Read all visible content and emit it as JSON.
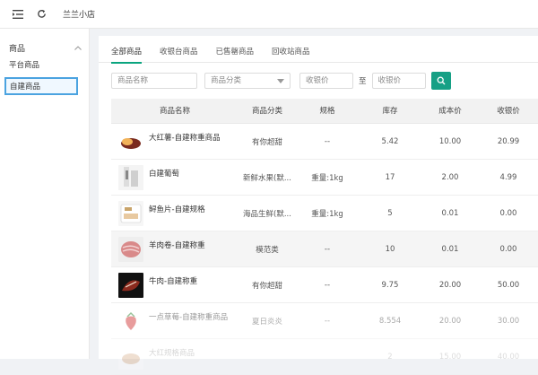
{
  "header": {
    "shop_name": "兰兰小店",
    "menu_icon": "menu-fold-icon",
    "refresh_icon": "refresh-icon"
  },
  "sidebar": {
    "group_label": "商品",
    "items": [
      {
        "label": "平台商品",
        "active": false
      },
      {
        "label": "自建商品",
        "active": true
      }
    ]
  },
  "tabs": [
    {
      "label": "全部商品",
      "active": true
    },
    {
      "label": "收银台商品",
      "active": false
    },
    {
      "label": "已售罄商品",
      "active": false
    },
    {
      "label": "回收站商品",
      "active": false
    }
  ],
  "filters": {
    "name_placeholder": "商品名称",
    "category_placeholder": "商品分类",
    "price_min_placeholder": "收银价",
    "to_label": "至",
    "price_max_placeholder": "收银价"
  },
  "accent_color": "#16a085",
  "table": {
    "columns": [
      "商品名称",
      "商品分类",
      "规格",
      "库存",
      "成本价",
      "收银价"
    ],
    "rows": [
      {
        "name": "大红薯-自建称重商品",
        "category": "有你超甜",
        "spec": "--",
        "stock": "5.42",
        "cost": "10.00",
        "price": "20.99"
      },
      {
        "name": "白建葡萄",
        "category": "新鲜水果(默...",
        "spec": "重量:1kg",
        "stock": "17",
        "cost": "2.00",
        "price": "4.99"
      },
      {
        "name": "鲟鱼片-自建规格",
        "category": "海品生鲜(默...",
        "spec": "重量:1kg",
        "stock": "5",
        "cost": "0.01",
        "price": "0.00"
      },
      {
        "name": "羊肉卷-自建称重",
        "category": "模范类",
        "spec": "--",
        "stock": "10",
        "cost": "0.01",
        "price": "0.00"
      },
      {
        "name": "牛肉-自建称重",
        "category": "有你超甜",
        "spec": "--",
        "stock": "9.75",
        "cost": "20.00",
        "price": "50.00"
      },
      {
        "name": "一点草莓-自建称重商品",
        "category": "夏日炎炎",
        "spec": "--",
        "stock": "8.554",
        "cost": "20.00",
        "price": "30.00"
      },
      {
        "name": "大红规格商品",
        "category": "",
        "spec": "",
        "stock": "2",
        "cost": "15.00",
        "price": "40.00"
      }
    ]
  }
}
